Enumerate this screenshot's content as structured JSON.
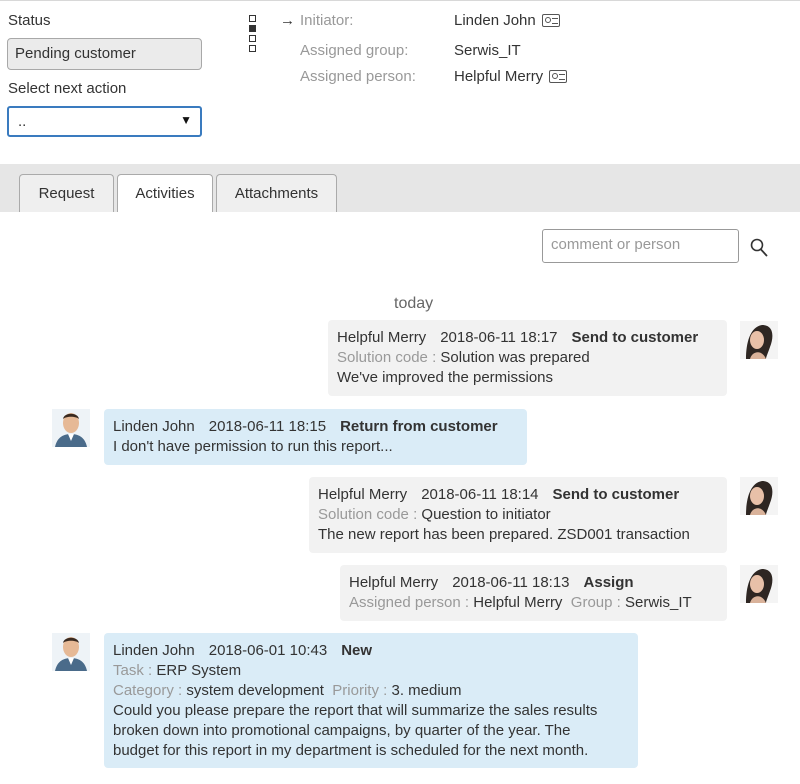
{
  "status": {
    "label": "Status",
    "value": "Pending customer"
  },
  "next_action": {
    "label": "Select next action",
    "value": "..",
    "caret": "▼"
  },
  "steps": [
    {
      "state": "empty"
    },
    {
      "state": "filled"
    },
    {
      "state": "empty"
    },
    {
      "state": "empty"
    }
  ],
  "info": {
    "arrow": "→",
    "initiator": {
      "key": "Initiator:",
      "value": "Linden John",
      "icon": "contact-card-icon"
    },
    "group": {
      "key": "Assigned group:",
      "value": "Serwis_IT"
    },
    "person": {
      "key": "Assigned person:",
      "value": "Helpful Merry",
      "icon": "contact-card-icon"
    }
  },
  "tabs": [
    {
      "label": "Request",
      "active": false
    },
    {
      "label": "Activities",
      "active": true
    },
    {
      "label": "Attachments",
      "active": false
    }
  ],
  "search": {
    "placeholder": "comment or person",
    "icon": "search-icon"
  },
  "day_label": "today",
  "activities": [
    {
      "side": "right",
      "author": "Helpful Merry",
      "datetime": "2018-06-11 18:17",
      "action": "Send to customer",
      "fields": [
        {
          "key": "Solution code :",
          "value": "Solution was prepared"
        }
      ],
      "text": [
        "We've improved the permissions"
      ]
    },
    {
      "side": "left",
      "author": "Linden John",
      "datetime": "2018-06-11 18:15",
      "action": "Return from customer",
      "fields": [],
      "text": [
        "I don't have permission to run this report..."
      ]
    },
    {
      "side": "right",
      "author": "Helpful Merry",
      "datetime": "2018-06-11 18:14",
      "action": "Send to customer",
      "fields": [
        {
          "key": "Solution code :",
          "value": "Question to initiator"
        }
      ],
      "text": [
        "The new report has been prepared. ZSD001 transaction"
      ]
    },
    {
      "side": "right",
      "author": "Helpful Merry",
      "datetime": "2018-06-11 18:13",
      "action": "Assign",
      "fields": [
        {
          "key": "Assigned person :",
          "value": "Helpful Merry"
        },
        {
          "key": "Group :",
          "value": "Serwis_IT"
        }
      ],
      "text": []
    },
    {
      "side": "left",
      "author": "Linden John",
      "datetime": "2018-06-01 10:43",
      "action": "New",
      "fields": [
        {
          "key": "Task :",
          "value": "ERP System"
        }
      ],
      "fields2": [
        {
          "key": "Category :",
          "value": "system development"
        },
        {
          "key": "Priority :",
          "value": "3. medium"
        }
      ],
      "text": [
        "Could you please prepare the report that will summarize the sales results",
        "broken down into promotional campaigns, by quarter of the year. The",
        "budget for this report in my department is scheduled for the next month."
      ]
    }
  ],
  "colors": {
    "accent": "#3a7bbf",
    "bubble_mine": "#f2f2f2",
    "bubble_theirs": "#daecf7",
    "tabbar": "#e6e6e6"
  }
}
